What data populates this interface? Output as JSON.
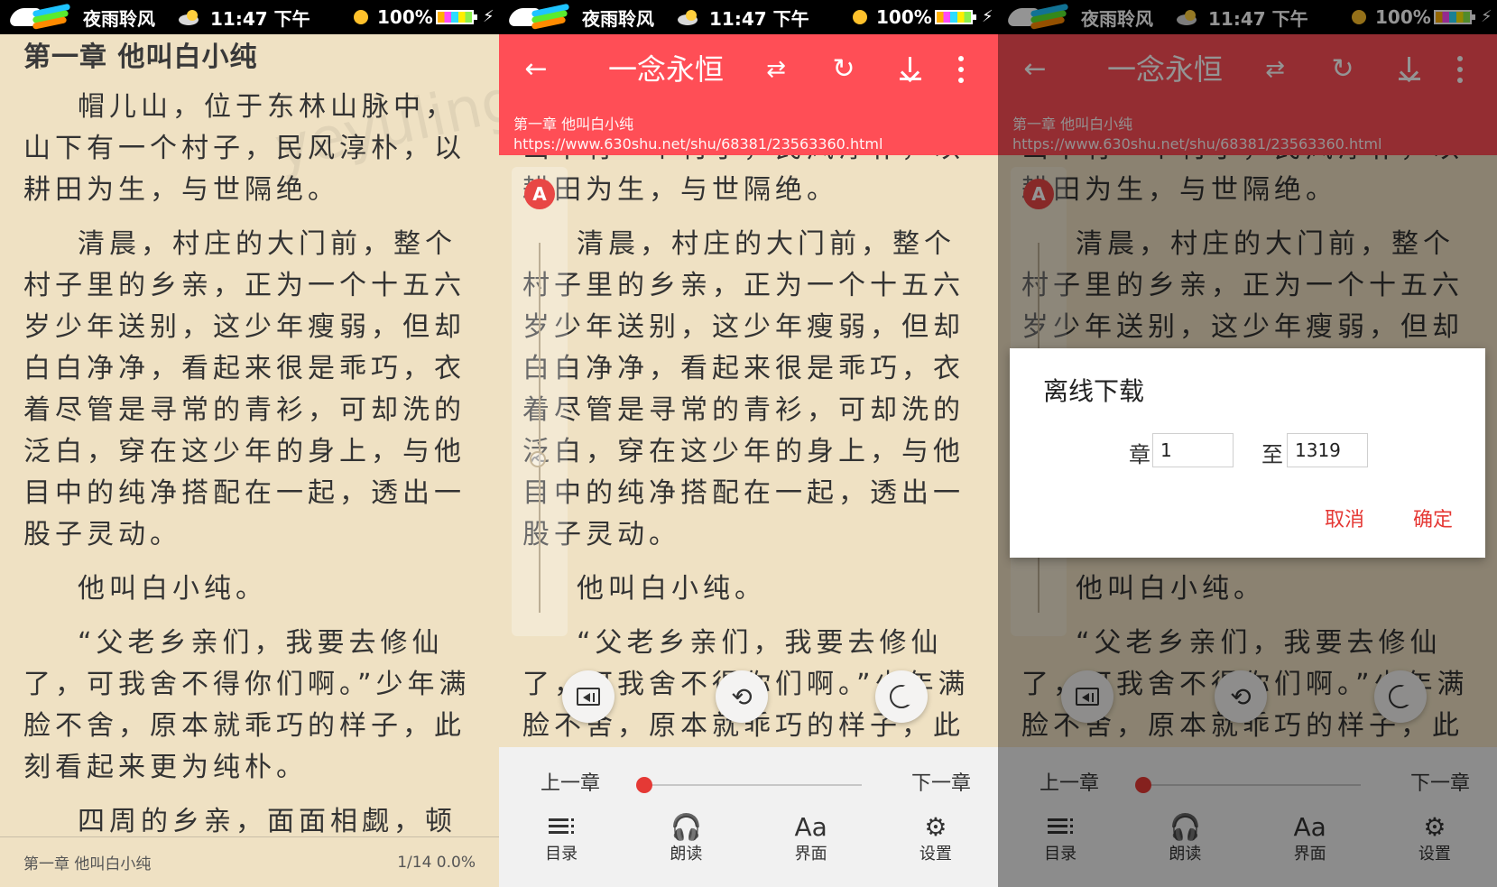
{
  "status": {
    "app_name": "夜雨聆风",
    "time": "11:47 下午",
    "battery": "100%"
  },
  "reader": {
    "chapter_title": "第一章 他叫白小纯",
    "paragraphs": [
      "帽儿山，位于东林山脉中，山下有一个村子，民风淳朴，以耕田为生，与世隔绝。",
      "清晨，村庄的大门前，整个村子里的乡亲，正为一个十五六岁少年送别，这少年瘦弱，但却白白净净，看起来很是乖巧，衣着尽管是寻常的青衫，可却洗的泛白，穿在这少年的身上，与他目中的纯净搭配在一起，透出一股子灵动。",
      "他叫白小纯。",
      "“父老乡亲们，我要去修仙了，可我舍不得你们啊。”少年满脸不舍，原本就乖巧的样子，此刻看起来更为纯朴。",
      "四周的乡亲，面面相觑，顿"
    ],
    "footer_left": "第一章 他叫白小纯",
    "footer_right": "1/14  0.0%"
  },
  "toolbar": {
    "title": "一念永恒",
    "chapter": "第一章 他叫白小纯",
    "url": "https://www.630shu.net/shu/68381/23563360.html",
    "back_icon": "back-arrow-icon",
    "shuffle_icon": "shuffle-icon",
    "refresh_icon": "refresh-icon",
    "download_icon": "download-icon",
    "more_icon": "more-icon"
  },
  "controls": {
    "prev_chapter": "上一章",
    "next_chapter": "下一章",
    "progress": 0.03,
    "tabs": [
      {
        "label": "目录",
        "icon": "list-icon"
      },
      {
        "label": "朗读",
        "icon": "headphones-icon"
      },
      {
        "label": "界面",
        "icon": "font-icon"
      },
      {
        "label": "设置",
        "icon": "gear-icon"
      }
    ],
    "auto_badge": "A"
  },
  "dialog": {
    "title": "离线下载",
    "from_label": "章",
    "to_label": "至",
    "from_value": "1",
    "to_value": "1319",
    "cancel": "取消",
    "confirm": "确定"
  },
  "watermark": {
    "text": "yeyulingfeng.com"
  },
  "colors": {
    "accent": "#ff4e56",
    "accent_dark": "#e53935",
    "paper": "#efe1c3"
  }
}
